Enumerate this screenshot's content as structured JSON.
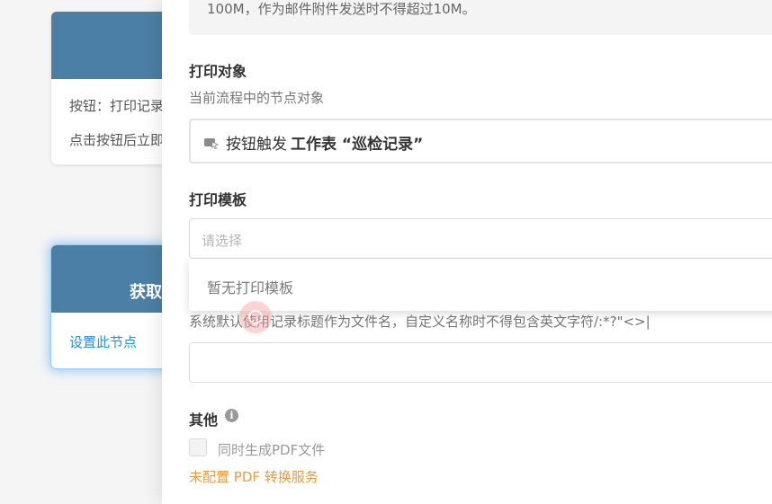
{
  "background": {
    "card1": {
      "line1": "按钮：打印记录",
      "line2": "点击按钮后立即"
    },
    "card2": {
      "title": "获取",
      "link": "设置此节点"
    }
  },
  "panel": {
    "notice_text": "100M，作为邮件附件发送时不得超过10M。",
    "print_target": {
      "title": "打印对象",
      "desc": "当前流程中的节点对象",
      "icon": "button-trigger-icon",
      "prefix": "按钮触发",
      "value": "工作表 “巡检记录”"
    },
    "print_template": {
      "title": "打印模板",
      "placeholder": "请选择",
      "dropdown_empty": "暂无打印模板"
    },
    "filename": {
      "desc": "系统默认使用记录标题作为文件名，自定义名称时不得包含英文字符/:*?\"<>|",
      "value": ""
    },
    "other": {
      "title": "其他",
      "info_icon": "info-icon",
      "pdf_checkbox_label": "同时生成PDF文件",
      "pdf_checked": false,
      "warning_link": "未配置 PDF 转换服务"
    }
  },
  "colors": {
    "card_header": "#4b7fa5",
    "link_blue": "#2d8fd5",
    "warning_orange": "#ef9a3c"
  }
}
